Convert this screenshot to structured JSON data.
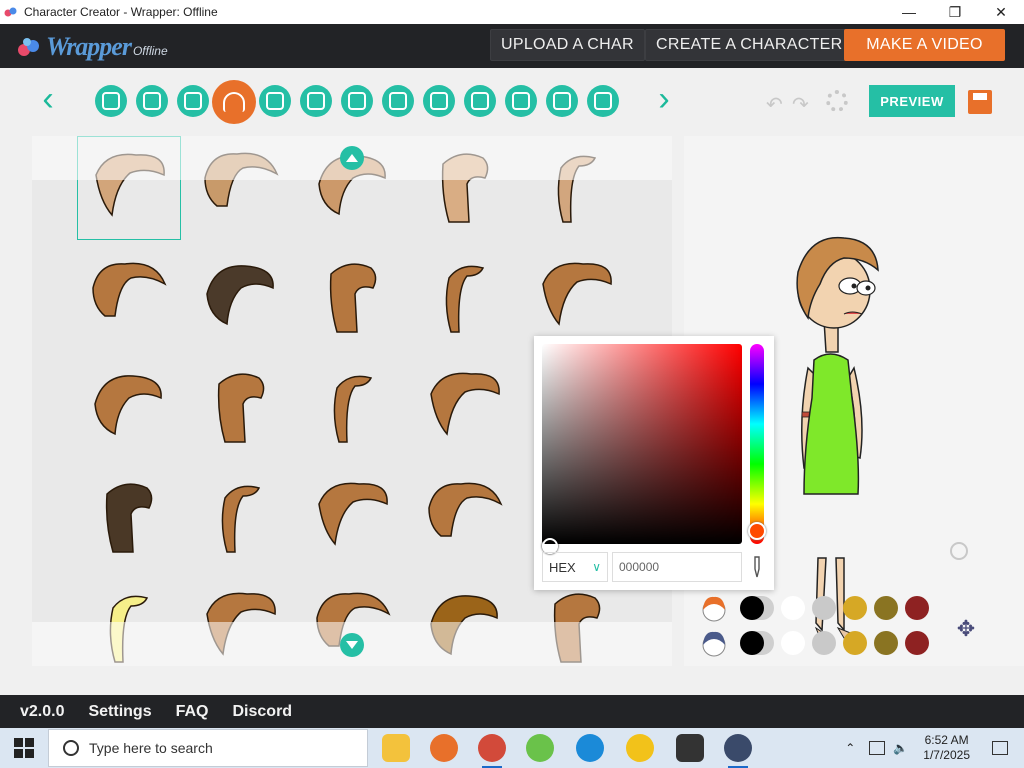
{
  "window": {
    "title": "Character Creator - Wrapper: Offline"
  },
  "header": {
    "logo_text": "Wrapper",
    "logo_sub": "Offline",
    "upload_label": "UPLOAD A CHAR",
    "create_label": "CREATE A CHARACTER",
    "video_label": "MAKE A VIDEO"
  },
  "toolbar": {
    "categories": [
      "shirt-icon",
      "pants-icon",
      "face-icon",
      "hair-icon",
      "head-icon",
      "mouth-icon",
      "ear-icon",
      "eyebrow-icon",
      "eye-icon",
      "eyelid-icon",
      "nose-icon",
      "glasses-icon",
      "beard-icon"
    ],
    "active_category": 3,
    "preview_label": "PREVIEW"
  },
  "hair_grid": {
    "rows": 5,
    "cols": 5,
    "selected": 0,
    "colors": [
      "#d2a57a",
      "#c89a6a",
      "#cc996a",
      "#d9ad84",
      "#d2a67e",
      "#b5773f",
      "#4b3a2a",
      "#b5773f",
      "#b5773f",
      "#b5773f",
      "#b5773f",
      "#b5773f",
      "#b5773f",
      "#b5773f",
      "#c9a780",
      "#4a3826",
      "#b5773f",
      "#b5773f",
      "#b5773f",
      "#b5773f",
      "#f6ef8a",
      "#b5773f",
      "#b5773f",
      "#9b6419",
      "#b5773f"
    ]
  },
  "color_picker": {
    "format": "HEX",
    "value": "000000",
    "hue": "#ff0000"
  },
  "swatches": {
    "row1": [
      "#000000",
      "#ffffff",
      "#c9c9c9",
      "#d6a825",
      "#8a7422",
      "#8e2222"
    ],
    "row2": [
      "#000000",
      "#ffffff",
      "#c9c9c9",
      "#d6a825",
      "#8a7422",
      "#8e2222"
    ]
  },
  "footer": {
    "version": "v2.0.0",
    "settings": "Settings",
    "faq": "FAQ",
    "discord": "Discord"
  },
  "taskbar": {
    "search_placeholder": "Type here to search",
    "time": "6:52 AM",
    "date": "1/7/2025"
  }
}
